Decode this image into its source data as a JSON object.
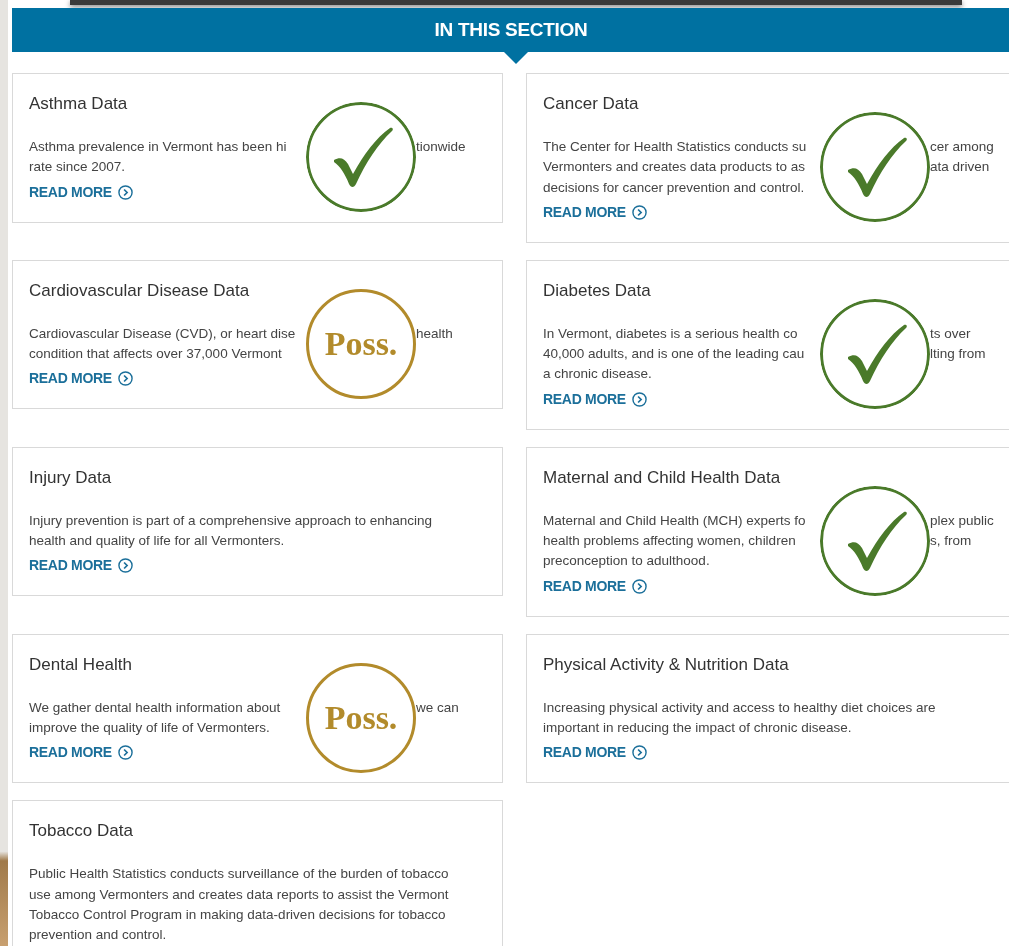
{
  "section_header": "IN THIS SECTION",
  "cards": [
    {
      "title": "Asthma Data",
      "lines": [
        [
          "Asthma prevalence in Vermont has been hi",
          "tionwide"
        ],
        [
          "rate since 2007."
        ]
      ],
      "link": "READ MORE",
      "stamp": {
        "kind": "check"
      }
    },
    {
      "title": "Cancer Data",
      "lines": [
        [
          "The Center for Health Statistics conducts su",
          "cer among"
        ],
        [
          "Vermonters and creates data products to as",
          "ata driven"
        ],
        [
          "decisions for cancer prevention and control."
        ]
      ],
      "link": "READ MORE",
      "stamp": {
        "kind": "check"
      }
    },
    {
      "title": "Cardiovascular Disease Data",
      "lines": [
        [
          "Cardiovascular Disease (CVD), or heart dise",
          "health"
        ],
        [
          "condition that affects over 37,000 Vermont"
        ]
      ],
      "link": "READ MORE",
      "stamp": {
        "kind": "poss",
        "label": "Poss."
      }
    },
    {
      "title": "Diabetes Data",
      "lines": [
        [
          "In Vermont, diabetes is a serious health co",
          "ts over"
        ],
        [
          "40,000 adults, and is one of the leading cau",
          "lting from"
        ],
        [
          "a chronic disease."
        ]
      ],
      "link": "READ MORE",
      "stamp": {
        "kind": "check"
      }
    },
    {
      "title": "Injury Data",
      "text": "Injury prevention is part of a comprehensive approach to enhancing health and quality of life for all Vermonters.",
      "link": "READ MORE"
    },
    {
      "title": "Maternal and Child Health Data",
      "lines": [
        [
          "Maternal and Child Health (MCH) experts fo",
          "plex public"
        ],
        [
          "health problems affecting women, children",
          "s, from"
        ],
        [
          "preconception to adulthood."
        ]
      ],
      "link": "READ MORE",
      "stamp": {
        "kind": "check"
      }
    },
    {
      "title": "Dental Health",
      "lines": [
        [
          "We gather dental health information about",
          "we can"
        ],
        [
          "improve the quality of life of Vermonters."
        ]
      ],
      "link": "READ MORE",
      "stamp": {
        "kind": "poss",
        "label": "Poss."
      }
    },
    {
      "title": "Physical Activity & Nutrition Data",
      "text": "Increasing physical activity and access to healthy diet choices are important in reducing the impact of chronic disease.",
      "link": "READ MORE"
    },
    {
      "title": "Tobacco Data",
      "text": "Public Health Statistics conducts surveillance of the burden of tobacco use among Vermonters and creates data reports to assist the Vermont Tobacco Control Program in making data-driven decisions for tobacco prevention and control."
    }
  ]
}
